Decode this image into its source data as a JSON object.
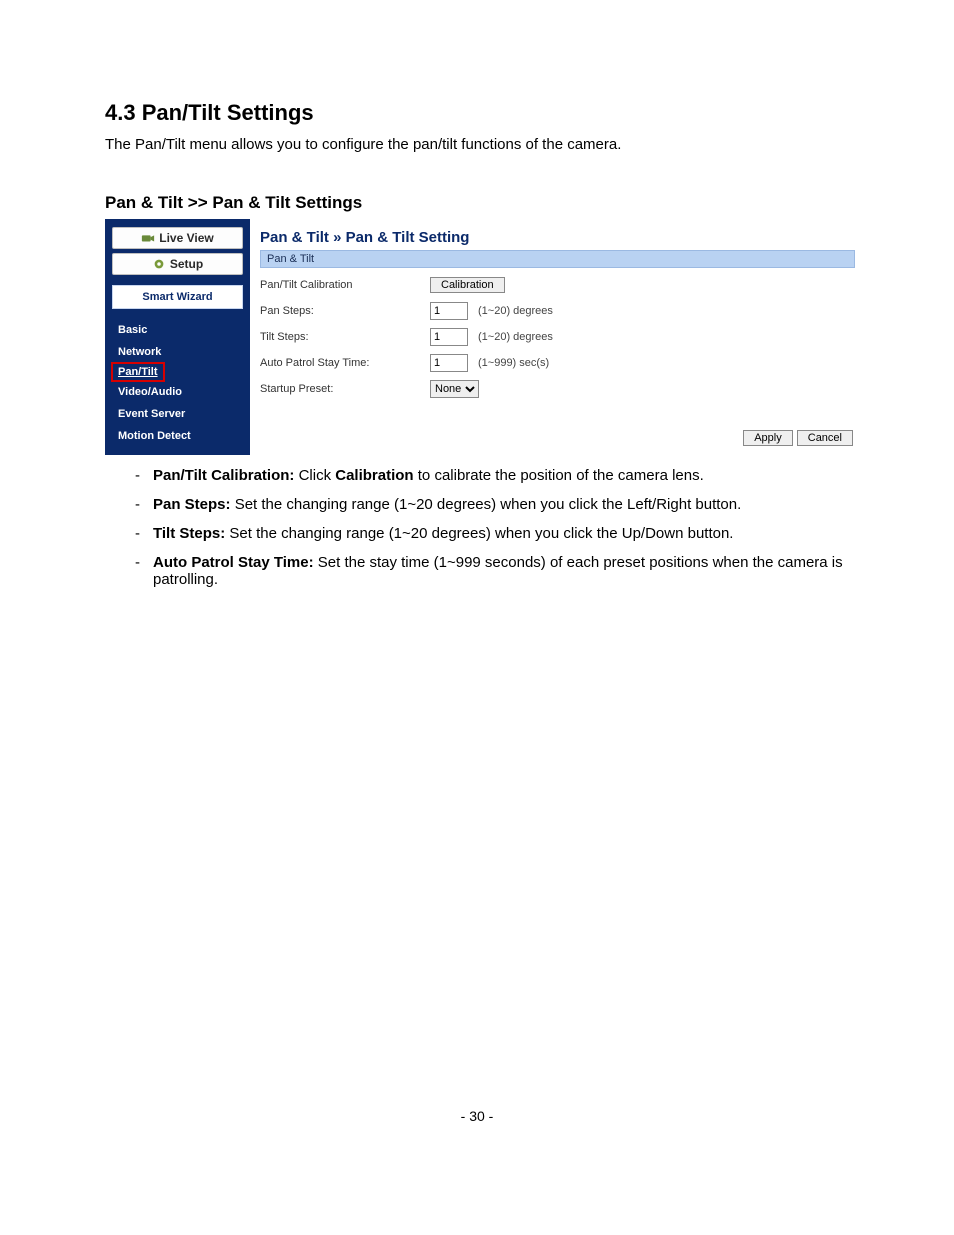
{
  "section_number": "4.3",
  "section_title": "4.3  Pan/Tilt Settings",
  "intro": "The Pan/Tilt menu allows you to configure the pan/tilt functions of the camera.",
  "subheading": "Pan & Tilt >> Pan & Tilt Settings",
  "sidebar": {
    "tabs": {
      "live_view": "Live View",
      "setup": "Setup"
    },
    "wizard": "Smart Wizard",
    "items": [
      "Basic",
      "Network",
      "Pan/Tilt",
      "Video/Audio",
      "Event Server",
      "Motion Detect"
    ],
    "active_index": 2
  },
  "main": {
    "breadcrumb": "Pan & Tilt » Pan & Tilt Setting",
    "band": "Pan & Tilt",
    "rows": {
      "calibration": {
        "label": "Pan/Tilt Calibration",
        "button": "Calibration"
      },
      "pan_steps": {
        "label": "Pan Steps:",
        "value": "1",
        "hint": "(1~20) degrees"
      },
      "tilt_steps": {
        "label": "Tilt Steps:",
        "value": "1",
        "hint": "(1~20) degrees"
      },
      "auto_patrol": {
        "label": "Auto Patrol Stay Time:",
        "value": "1",
        "hint": "(1~999) sec(s)"
      },
      "startup": {
        "label": "Startup Preset:",
        "value": "None"
      }
    },
    "buttons": {
      "apply": "Apply",
      "cancel": "Cancel"
    }
  },
  "bullets": [
    {
      "strong": "Pan/Tilt Calibration:",
      "rest": " Click ",
      "strong2": "Calibration",
      "rest2": " to calibrate the position of the camera lens."
    },
    {
      "strong": "Pan Steps:",
      "rest": " Set the changing range (1~20 degrees) when you click the Left/Right button."
    },
    {
      "strong": "Tilt Steps:",
      "rest": " Set the changing range (1~20 degrees) when you click the Up/Down button."
    },
    {
      "strong": "Auto Patrol Stay Time:",
      "rest": " Set the stay time (1~999 seconds) of each preset positions when the camera is patrolling."
    }
  ],
  "page_number": "- 30 -"
}
